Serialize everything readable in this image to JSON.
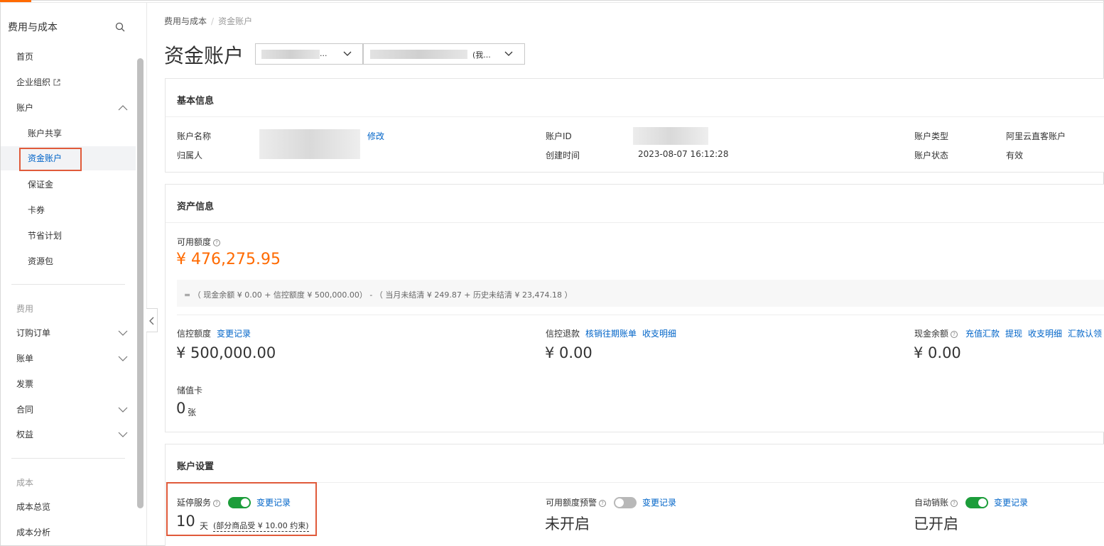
{
  "sidebar": {
    "title": "费用与成本",
    "items": {
      "home": "首页",
      "org": "企业组织",
      "account": "账户",
      "account_share": "账户共享",
      "fund_account": "资金账户",
      "deposit": "保证金",
      "coupons": "卡券",
      "savings_plan": "节省计划",
      "resource_pack": "资源包",
      "group_fee": "费用",
      "orders": "订购订单",
      "bills": "账单",
      "invoice": "发票",
      "contract": "合同",
      "rights": "权益",
      "group_cost": "成本",
      "cost_overview": "成本总览",
      "cost_analysis": "成本分析"
    }
  },
  "breadcrumb": {
    "parent": "费用与成本",
    "sep": "/",
    "current": "资金账户"
  },
  "header": {
    "title": "资金账户",
    "select1_tail": "...",
    "select2_tail": "(我..."
  },
  "basic_info": {
    "heading": "基本信息",
    "account_name_label": "账户名称",
    "modify": "修改",
    "owner_label": "归属人",
    "account_id_label": "账户ID",
    "created_label": "创建时间",
    "created_value": "2023-08-07 16:12:28",
    "type_label": "账户类型",
    "type_value": "阿里云直客账户",
    "status_label": "账户状态",
    "status_value": "有效"
  },
  "asset_info": {
    "heading": "资产信息",
    "available_label": "可用额度",
    "available_value": "¥ 476,275.95",
    "formula": "= （ 现金余额 ¥ 0.00 + 信控额度 ¥ 500,000.00） - （ 当月未结清 ¥ 249.87 + 历史未结清 ¥ 23,474.18 ）",
    "credit_label": "信控额度",
    "credit_link": "变更记录",
    "credit_value": "¥ 500,000.00",
    "refund_label": "信控退款",
    "refund_link1": "核销往期账单",
    "refund_link2": "收支明细",
    "refund_value": "¥ 0.00",
    "cash_label": "现金余额",
    "cash_links": [
      "充值汇款",
      "提现",
      "收支明细",
      "汇款认领"
    ],
    "cash_value": "¥ 0.00",
    "card_label": "储值卡",
    "card_count": "0",
    "card_unit": "张"
  },
  "settings": {
    "heading": "账户设置",
    "suspend_label": "延停服务",
    "suspend_on": true,
    "suspend_link": "变更记录",
    "suspend_days": "10",
    "suspend_unit": "天",
    "suspend_note": "(部分商品受 ¥ 10.00 约束)",
    "alert_label": "可用额度预警",
    "alert_on": false,
    "alert_link": "变更记录",
    "alert_value": "未开启",
    "auto_label": "自动销账",
    "auto_on": true,
    "auto_link": "变更记录",
    "auto_value": "已开启"
  },
  "colors": {
    "accent": "#ff6a00",
    "link": "#0064c8",
    "toggle_on": "#1c9d3a",
    "highlight_box": "#e05a3a"
  }
}
